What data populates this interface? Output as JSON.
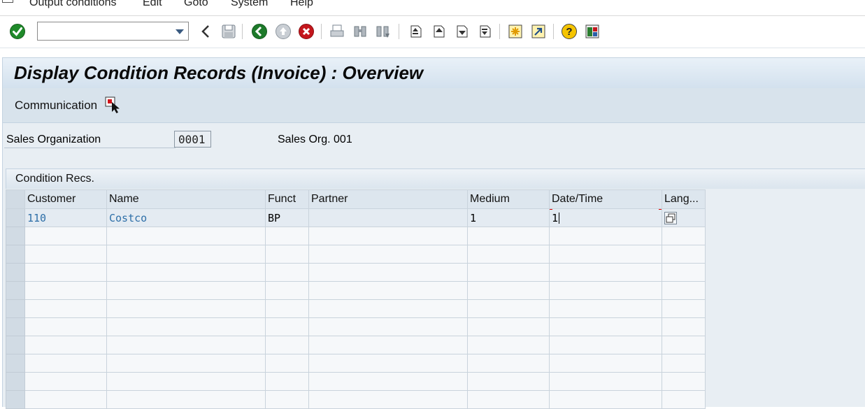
{
  "menu": {
    "items": [
      "Output conditions",
      "Edit",
      "Goto",
      "System",
      "Help"
    ]
  },
  "toolbar": {
    "command_field_value": "",
    "icons": [
      "enter-icon",
      "back-arrow-icon",
      "save-icon",
      "back-icon",
      "exit-icon",
      "cancel-icon",
      "print-icon",
      "find-icon",
      "find-next-icon",
      "first-page-icon",
      "previous-page-icon",
      "next-page-icon",
      "last-page-icon",
      "create-session-icon",
      "shortcut-icon",
      "help-icon",
      "customize-layout-icon"
    ]
  },
  "title": "Display Condition Records (Invoice) : Overview",
  "app_toolbar": {
    "communication_label": "Communication"
  },
  "header": {
    "sales_org_label": "Sales Organization",
    "sales_org_value": "0001",
    "sales_org_text": "Sales Org. 001"
  },
  "table": {
    "title": "Condition Recs.",
    "columns": [
      "Customer",
      "Name",
      "Funct",
      "Partner",
      "Medium",
      "Date/Time",
      "Lang..."
    ],
    "rows": [
      {
        "customer": "110",
        "name": "Costco",
        "funct": "BP",
        "partner": "",
        "medium": "1",
        "datetime": "1",
        "lang": ""
      }
    ],
    "empty_rows": 10
  },
  "colors": {
    "title_bar": "#d3e1ee",
    "link_text": "#2e6fa8",
    "focus_bracket": "#dd0000"
  }
}
